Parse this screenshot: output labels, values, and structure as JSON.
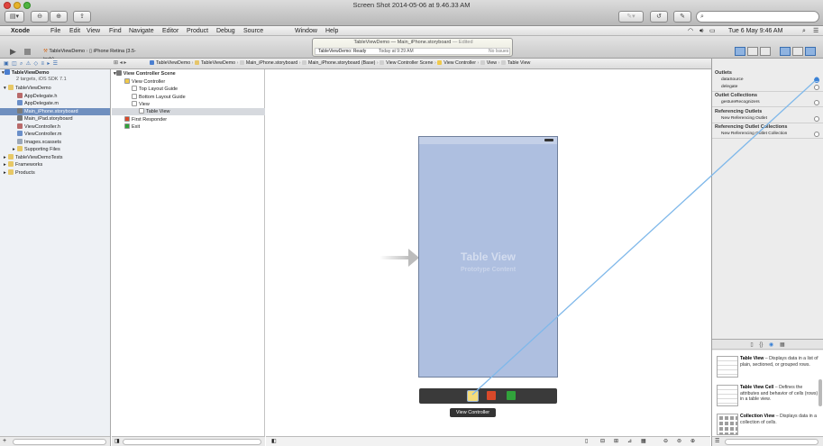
{
  "window": {
    "title": "Screen Shot 2014-05-06 at 9.46.33 AM",
    "search_placeholder": ""
  },
  "menubar": {
    "items": [
      "Xcode",
      "File",
      "Edit",
      "View",
      "Find",
      "Navigate",
      "Editor",
      "Product",
      "Debug",
      "Source Control",
      "Window",
      "Help"
    ],
    "clock": "Tue 6 May 9:46 AM"
  },
  "toolbar": {
    "scheme": "TableViewDemo",
    "device": "iPhone Retina (3.5-inch)",
    "status_title": "TableViewDemo",
    "status_file": "Main_iPhone.storyboard",
    "status_edited": "— Edited",
    "status_text": "TableViewDemo: Ready",
    "status_time": "Today at 9:29 AM",
    "status_issues": "No Issues"
  },
  "jumpbar": [
    "TableViewDemo",
    "TableViewDemo",
    "Main_iPhone.storyboard",
    "Main_iPhone.storyboard (Base)",
    "View Controller Scene",
    "View Controller",
    "View",
    "Table View"
  ],
  "navigator": {
    "project": "TableViewDemo",
    "project_sub": "2 targets, iOS SDK 7.1",
    "items": [
      {
        "label": "TableViewDemo",
        "level": 1,
        "kind": "folder"
      },
      {
        "label": "AppDelegate.h",
        "level": 2,
        "kind": "h"
      },
      {
        "label": "AppDelegate.m",
        "level": 2,
        "kind": "m"
      },
      {
        "label": "Main_iPhone.storyboard",
        "level": 2,
        "kind": "sb",
        "selected": true
      },
      {
        "label": "Main_iPad.storyboard",
        "level": 2,
        "kind": "sb"
      },
      {
        "label": "ViewController.h",
        "level": 2,
        "kind": "h"
      },
      {
        "label": "ViewController.m",
        "level": 2,
        "kind": "m"
      },
      {
        "label": "Images.xcassets",
        "level": 2,
        "kind": "assets"
      },
      {
        "label": "Supporting Files",
        "level": 2,
        "kind": "folder"
      },
      {
        "label": "TableViewDemoTests",
        "level": 1,
        "kind": "folder"
      },
      {
        "label": "Frameworks",
        "level": 1,
        "kind": "folder"
      },
      {
        "label": "Products",
        "level": 1,
        "kind": "folder"
      }
    ]
  },
  "outline": {
    "scene": "View Controller Scene",
    "items": [
      {
        "label": "View Controller",
        "level": 1
      },
      {
        "label": "Top Layout Guide",
        "level": 2
      },
      {
        "label": "Bottom Layout Guide",
        "level": 2
      },
      {
        "label": "View",
        "level": 2
      },
      {
        "label": "Table View",
        "level": 3,
        "selected": true
      },
      {
        "label": "First Responder",
        "level": 1
      },
      {
        "label": "Exit",
        "level": 1
      }
    ]
  },
  "canvas": {
    "table_title": "Table View",
    "table_sub": "Prototype Content",
    "tooltip": "View Controller"
  },
  "inspector": {
    "sections": [
      {
        "title": "Outlets",
        "rows": [
          "dataSource",
          "delegate"
        ]
      },
      {
        "title": "Outlet Collections",
        "rows": [
          "gestureRecognizers"
        ]
      },
      {
        "title": "Referencing Outlets",
        "rows": [
          "New Referencing Outlet"
        ]
      },
      {
        "title": "Referencing Outlet Collections",
        "rows": [
          "New Referencing Outlet Collection"
        ]
      }
    ],
    "library": [
      {
        "name": "Table View",
        "desc": "– Displays data in a list of plain, sectioned, or grouped rows."
      },
      {
        "name": "Table View Cell",
        "desc": "– Defines the attributes and behavior of cells (rows) in a table view."
      },
      {
        "name": "Collection View",
        "desc": "– Displays data in a collection of cells."
      }
    ]
  },
  "colors": {
    "accent": "#4a90d9",
    "connection": "#7fb8ea",
    "tableview": "#aebfe0",
    "dock": "#3a3a3a"
  }
}
